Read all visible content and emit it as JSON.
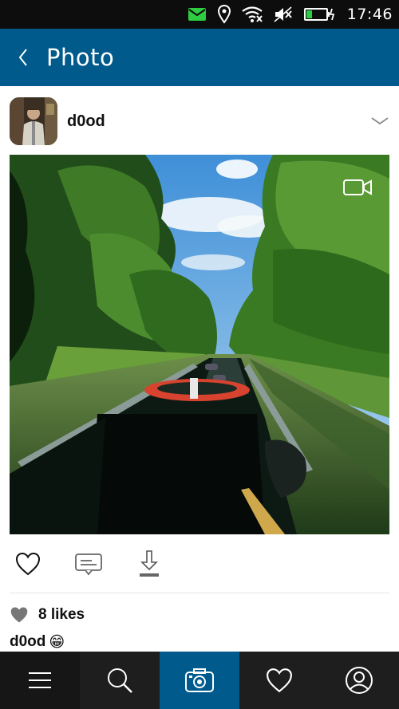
{
  "status_bar": {
    "time": "17:46",
    "icons": [
      "message-icon",
      "location-icon",
      "wifi-icon",
      "mute-icon",
      "battery-icon"
    ]
  },
  "header": {
    "title": "Photo",
    "back_icon": "chevron-left-icon"
  },
  "post": {
    "username": "d0od",
    "likes_text": "8 likes",
    "caption_user": "d0od",
    "caption_emoji": "😁",
    "media_type_icon": "video-camera-icon"
  },
  "actions": [
    "heart-icon",
    "comment-icon",
    "download-icon"
  ],
  "bottom_nav": {
    "items": [
      "menu-icon",
      "search-icon",
      "camera-icon",
      "heart-icon",
      "profile-icon"
    ],
    "active": "camera-icon"
  },
  "colors": {
    "accent": "#005a8c",
    "status_bar": "#0d0d0d",
    "nav_bg": "#1e1e1e",
    "message_icon": "#2ecc40",
    "battery_level": "#2ecc40"
  }
}
